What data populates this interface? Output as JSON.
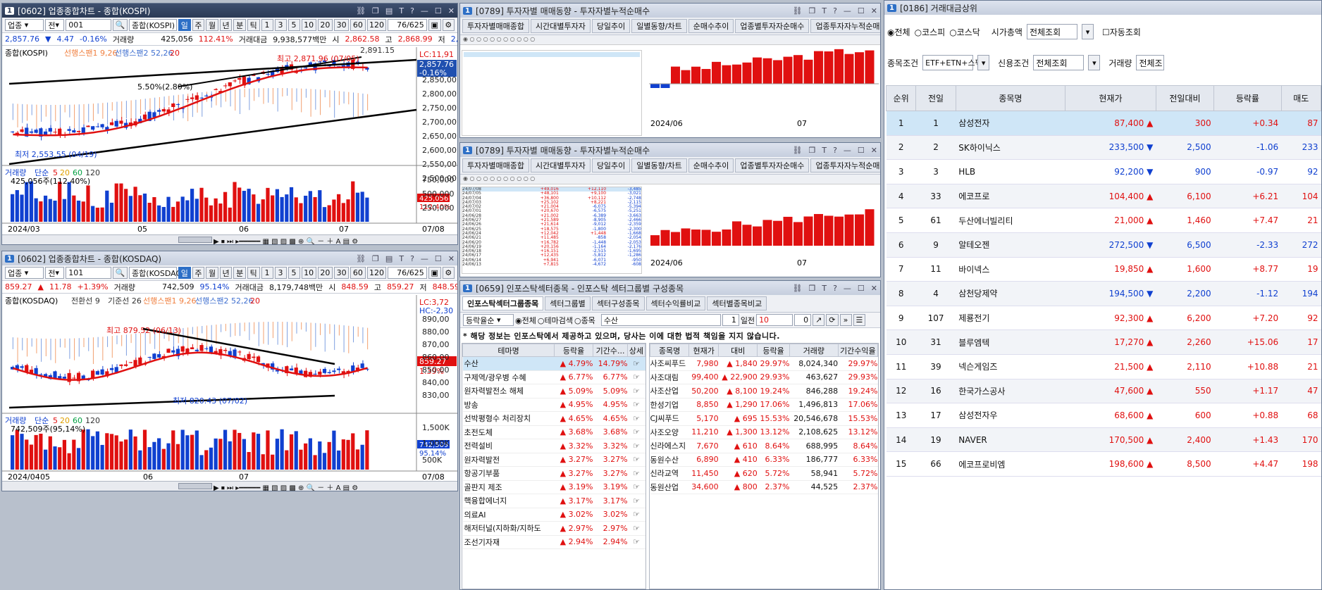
{
  "kospi": {
    "num": "1",
    "title": "[0602] 업종종합차트 - 종합(KOSPI)",
    "type_sel": "업종",
    "period_sel": "전",
    "code": "001",
    "name": "종합(KOSPI)",
    "periods": [
      "일",
      "주",
      "월",
      "년",
      "분",
      "틱"
    ],
    "intervals": [
      "1",
      "3",
      "5",
      "10",
      "20",
      "30",
      "60",
      "120"
    ],
    "count": "76/625",
    "info": {
      "price": "2,857.76",
      "arrow": "▼",
      "chg": "4.47",
      "rate": "-0.16%",
      "vol_label": "거래량",
      "vol": "425,056",
      "vol_rate": "112.41%",
      "amt_label": "거래대금",
      "amt": "9,938,577백만",
      "open_label": "시",
      "open": "2,862.58",
      "high_label": "고",
      "high": "2,868.99",
      "low_label": "저",
      "low": "2,855.53"
    },
    "legend": {
      "main": "종합(KOSPI)",
      "s1": "선행스팬1 9,26",
      "s2": "선행스팬2 52,26",
      "n": "20"
    },
    "lc": "LC:11,91",
    "last_price": "2,857.76",
    "last_rate": "-0.16%",
    "ann_high": "최고 2,871.96 (07/05)",
    "ann_top": "2,891.15",
    "ann_mid": "5.50%(2.80%)",
    "ann_low": "최저 2,553.55 (04/19)",
    "yticks": [
      "2,850,00",
      "2,800,00",
      "2,750,00",
      "2,700,00",
      "2,650,00",
      "2,600,00",
      "2,550,00",
      "2,500,00"
    ],
    "vol_legend": {
      "label": "거래량",
      "ma": "단순",
      "m5": "5",
      "m20": "20",
      "m60": "60",
      "m120": "120",
      "sub": "425,056주(112.40%)"
    },
    "vol_ticks": [
      "750,000",
      "500,000",
      "250,000"
    ],
    "vol_now": "425,056",
    "vol_now_rate": "112.40%",
    "dates": [
      "2024/03",
      "05",
      "06",
      "07",
      "07/08"
    ]
  },
  "kosdaq": {
    "num": "1",
    "title": "[0602] 업종종합차트 - 종합(KOSDAQ)",
    "type_sel": "업종",
    "period_sel": "전",
    "code": "101",
    "name": "종합(KOSDAQ)",
    "periods": [
      "일",
      "주",
      "월",
      "년",
      "분",
      "틱"
    ],
    "intervals": [
      "1",
      "3",
      "5",
      "10",
      "20",
      "30",
      "60",
      "120"
    ],
    "count": "76/625",
    "info": {
      "price": "859.27",
      "arrow": "▲",
      "chg": "11.78",
      "rate": "+1.39%",
      "vol_label": "거래량",
      "vol": "742,509",
      "vol_rate": "95.14%",
      "amt_label": "거래대금",
      "amt": "8,179,748백만",
      "open_label": "시",
      "open": "848.59",
      "high_label": "고",
      "high": "859.27",
      "low_label": "저",
      "low": "848.59"
    },
    "legend": {
      "main": "종합(KOSDAQ)",
      "t": "전환선 9",
      "k": "기준선 26",
      "s1": "선행스팬1 9,26",
      "s2": "선행스팬2 52,26",
      "n": "20"
    },
    "lc": "LC:3,72",
    "hc": "HC:-2,30",
    "last_price": "859.27",
    "last_rate": "1.39%",
    "ann_high": "최고 879.52 (06/13)",
    "ann_low": "최저 820.43 (07/02)",
    "yticks": [
      "890,00",
      "880,00",
      "870,00",
      "860,00",
      "850,00",
      "840,00",
      "830,00"
    ],
    "vol_legend": {
      "label": "거래량",
      "ma": "단순",
      "m5": "5",
      "m20": "20",
      "m60": "60",
      "m120": "120",
      "sub": "742,509주(95,14%)"
    },
    "vol_ticks": [
      "1,500K",
      "1,000K",
      "500K"
    ],
    "vol_now": "742,509",
    "vol_now_rate": "95.14%",
    "dates": [
      "2024/04",
      "05",
      "06",
      "07",
      "07/08"
    ]
  },
  "inv1": {
    "num": "1",
    "title": "[0789] 투자자별 매매동향 - 투자자별누적순매수",
    "tabs": [
      "투자자별매매종합",
      "시간대별투자자",
      "당일추이",
      "일별동향/차트",
      "순매수추이",
      "업종별투자자순매수",
      "업종투자자누적순매수"
    ],
    "date_left": "2024/06",
    "date_right": "07"
  },
  "inv2": {
    "num": "1",
    "title": "[0789] 투자자별 매매동향 - 투자자별누적순매수",
    "tabs": [
      "투자자별매매종합",
      "시간대별투자자",
      "당일추이",
      "일별동향/차트",
      "순매수추이",
      "업종별투자자순매수",
      "업종투자자누적순매수"
    ],
    "date_left": "2024/06",
    "date_right": "07",
    "rows": [
      [
        "24/07/08",
        "+49,016",
        "+12,110",
        "-3,485"
      ],
      [
        "24/07/05",
        "+48,101",
        "+9,100",
        "-3,021"
      ],
      [
        "24/07/04",
        "+36,800",
        "+10,112",
        "-2,748"
      ],
      [
        "24/07/03",
        "+25,102",
        "+8,221",
        "-2,115"
      ],
      [
        "24/07/02",
        "+21,004",
        "-6,075",
        "-5,394"
      ],
      [
        "24/07/01",
        "+20,670",
        "-6,575",
        "-5,251"
      ],
      [
        "24/06/28",
        "+21,002",
        "-6,389",
        "-3,663"
      ],
      [
        "24/06/27",
        "+21,589",
        "-8,905",
        "-2,466"
      ],
      [
        "24/06/26",
        "+21,614",
        "-9,012",
        "-2,359"
      ],
      [
        "24/06/25",
        "+18,575",
        "-1,800",
        "-2,300"
      ],
      [
        "24/06/24",
        "+12,042",
        "+1,448",
        "-1,668"
      ],
      [
        "24/06/21",
        "+11,485",
        "-858",
        "-2,054"
      ],
      [
        "24/06/20",
        "+16,782",
        "-1,448",
        "-2,053"
      ],
      [
        "24/06/19",
        "+20,156",
        "-1,164",
        "-2,176"
      ],
      [
        "24/06/18",
        "+16,151",
        "-2,515",
        "-1,695"
      ],
      [
        "24/06/17",
        "+12,435",
        "-5,812",
        "-1,286"
      ],
      [
        "24/06/14",
        "+6,941",
        "-6,071",
        "-950"
      ],
      [
        "24/06/13",
        "+7,815",
        "-4,672",
        "-608"
      ]
    ]
  },
  "sector": {
    "num": "1",
    "title": "[0659] 인포스탁섹터종목 - 인포스탁 섹터그룹별 구성종목",
    "tabs": [
      "인포스탁섹터그룹종목",
      "섹터그룹별",
      "섹터구성종목",
      "섹터수익률비교",
      "섹터별종목비교"
    ],
    "sort": "등락율순",
    "radios": [
      "전체",
      "테마검색",
      "종목"
    ],
    "sector_name": "수산",
    "days": "1",
    "days_label": "일전",
    "val1": "10",
    "val2": "0",
    "notice": "* 해당 정보는 인포스탁에서 제공하고 있으며, 당사는 이에 대한 법적 책임을 지지 않습니다.",
    "left_headers": [
      "테마명",
      "등락율",
      "기간수...",
      "상세"
    ],
    "themes": [
      [
        "수산",
        "4.79%",
        "14.79%"
      ],
      [
        "구제역/광우병 수혜",
        "6.77%",
        "6.77%"
      ],
      [
        "원자력발전소 해체",
        "5.09%",
        "5.09%"
      ],
      [
        "방송",
        "4.95%",
        "4.95%"
      ],
      [
        "선박평형수 처리장치",
        "4.65%",
        "4.65%"
      ],
      [
        "초전도체",
        "3.68%",
        "3.68%"
      ],
      [
        "전력설비",
        "3.32%",
        "3.32%"
      ],
      [
        "원자력발전",
        "3.27%",
        "3.27%"
      ],
      [
        "항공기부품",
        "3.27%",
        "3.27%"
      ],
      [
        "골판지 제조",
        "3.19%",
        "3.19%"
      ],
      [
        "핵융합에너지",
        "3.17%",
        "3.17%"
      ],
      [
        "의료AI",
        "3.02%",
        "3.02%"
      ],
      [
        "해저터널(지하화/지하도",
        "2.97%",
        "2.97%"
      ],
      [
        "조선기자재",
        "2.94%",
        "2.94%"
      ]
    ],
    "right_headers": [
      "종목명",
      "현재가",
      "대비",
      "등락율",
      "거래량",
      "기간수익율"
    ],
    "stocks": [
      [
        "사조씨푸드",
        "7,980",
        "1,840",
        "29.97%",
        "8,024,340",
        "29.97%"
      ],
      [
        "사조대림",
        "99,400",
        "22,900",
        "29.93%",
        "463,627",
        "29.93%"
      ],
      [
        "사조산업",
        "50,200",
        "8,100",
        "19.24%",
        "846,288",
        "19.24%"
      ],
      [
        "한성기업",
        "8,850",
        "1,290",
        "17.06%",
        "1,496,813",
        "17.06%"
      ],
      [
        "CJ씨푸드",
        "5,170",
        "695",
        "15.53%",
        "20,546,678",
        "15.53%"
      ],
      [
        "사조오양",
        "11,210",
        "1,300",
        "13.12%",
        "2,108,625",
        "13.12%"
      ],
      [
        "신라에스지",
        "7,670",
        "610",
        "8.64%",
        "688,995",
        "8.64%"
      ],
      [
        "동원수산",
        "6,890",
        "410",
        "6.33%",
        "186,777",
        "6.33%"
      ],
      [
        "신라교역",
        "11,450",
        "620",
        "5.72%",
        "58,941",
        "5.72%"
      ],
      [
        "동원산업",
        "34,600",
        "800",
        "2.37%",
        "44,525",
        "2.37%"
      ]
    ]
  },
  "volrank": {
    "num": "1",
    "title": "[0186] 거래대금상위",
    "market_radios": [
      "전체",
      "코스피",
      "코스닥"
    ],
    "mcap_label": "시가총액",
    "mcap_val": "전체조회",
    "auto_label": "자동조회",
    "cond_label": "종목조건",
    "cond_val": "ETF+ETN+스팩",
    "credit_label": "신용조건",
    "credit_val": "전체조회",
    "vol_label": "거래량",
    "vol_val": "전체조",
    "headers": [
      "순위",
      "전일",
      "종목명",
      "현재가",
      "전일대비",
      "등락률",
      "매도"
    ],
    "rows": [
      [
        "1",
        "1",
        "삼성전자",
        "87,400",
        "▲",
        "300",
        "+0.34",
        "87"
      ],
      [
        "2",
        "2",
        "SK하이닉스",
        "233,500",
        "▼",
        "2,500",
        "-1.06",
        "233"
      ],
      [
        "3",
        "3",
        "HLB",
        "92,200",
        "▼",
        "900",
        "-0.97",
        "92"
      ],
      [
        "4",
        "33",
        "에코프로",
        "104,400",
        "▲",
        "6,100",
        "+6.21",
        "104"
      ],
      [
        "5",
        "61",
        "두산에너빌리티",
        "21,000",
        "▲",
        "1,460",
        "+7.47",
        "21"
      ],
      [
        "6",
        "9",
        "알테오젠",
        "272,500",
        "▼",
        "6,500",
        "-2.33",
        "272"
      ],
      [
        "7",
        "11",
        "바이넥스",
        "19,850",
        "▲",
        "1,600",
        "+8.77",
        "19"
      ],
      [
        "8",
        "4",
        "삼천당제약",
        "194,500",
        "▼",
        "2,200",
        "-1.12",
        "194"
      ],
      [
        "9",
        "107",
        "제룡전기",
        "92,300",
        "▲",
        "6,200",
        "+7.20",
        "92"
      ],
      [
        "10",
        "31",
        "블루엠텍",
        "17,270",
        "▲",
        "2,260",
        "+15.06",
        "17"
      ],
      [
        "11",
        "39",
        "넥슨게임즈",
        "21,500",
        "▲",
        "2,110",
        "+10.88",
        "21"
      ],
      [
        "12",
        "16",
        "한국가스공사",
        "47,600",
        "▲",
        "550",
        "+1.17",
        "47"
      ],
      [
        "13",
        "17",
        "삼성전자우",
        "68,600",
        "▲",
        "600",
        "+0.88",
        "68"
      ],
      [
        "14",
        "19",
        "NAVER",
        "170,500",
        "▲",
        "2,400",
        "+1.43",
        "170"
      ],
      [
        "15",
        "66",
        "에코프로비엠",
        "198,600",
        "▲",
        "8,500",
        "+4.47",
        "198"
      ]
    ]
  },
  "colors": {
    "up": "#e01010",
    "down": "#1040d0",
    "title_bar": "#2b3a55",
    "highlight": "#cfe6f7"
  }
}
